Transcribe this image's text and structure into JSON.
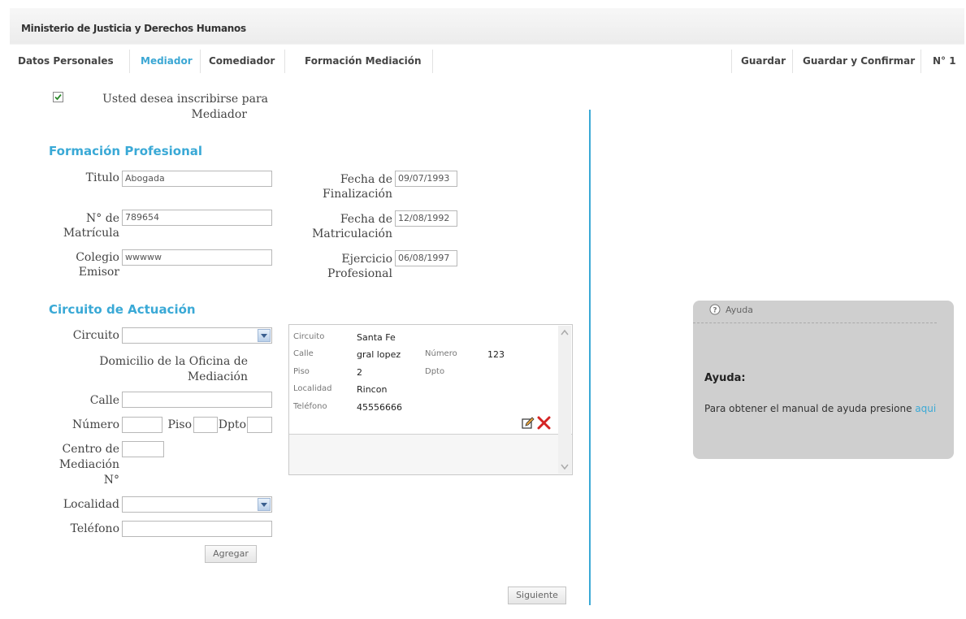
{
  "app_title": "Ministerio de Justicia y Derechos Humanos",
  "nav": {
    "tabs": [
      "Datos Personales",
      "Mediador",
      "Comediador",
      "Formación Mediación"
    ],
    "actions": [
      "Guardar",
      "Guardar y Confirmar",
      "N° 1"
    ]
  },
  "checkbox": {
    "label_line1": "Usted desea inscribirse para",
    "label_line2": "Mediador",
    "checked": true
  },
  "formacion": {
    "heading": "Formación Profesional",
    "titulo_label": "Titulo",
    "titulo_value": "Abogada",
    "matricula_label1": "N° de",
    "matricula_label2": "Matrícula",
    "matricula_value": "789654",
    "colegio_label1": "Colegio",
    "colegio_label2": "Emisor",
    "colegio_value": "wwwww",
    "fin_label1": "Fecha de",
    "fin_label2": "Finalización",
    "fin_value": "09/07/1993",
    "mat_label1": "Fecha de",
    "mat_label2": "Matriculación",
    "mat_value": "12/08/1992",
    "ej_label1": "Ejercicio",
    "ej_label2": "Profesional",
    "ej_value": "06/08/1997"
  },
  "circuito": {
    "heading": "Circuito de Actuación",
    "circuito_label": "Circuito",
    "domicilio_line1": "Domicilio de la Oficina de",
    "domicilio_line2": "Mediación",
    "calle_label": "Calle",
    "numero_label": "Número",
    "piso_label": "Piso",
    "dpto_label": "Dpto",
    "centro_line1": "Centro de",
    "centro_line2": "Mediación",
    "centro_line3": "N°",
    "localidad_label": "Localidad",
    "telefono_label": "Teléfono",
    "agregar": "Agregar"
  },
  "record": {
    "k_circuito": "Circuito",
    "v_circuito": "Santa Fe",
    "k_calle": "Calle",
    "v_calle": "gral lopez",
    "k_numero": "Número",
    "v_numero": "123",
    "k_piso": "Piso",
    "v_piso": "2",
    "k_dpto": "Dpto",
    "k_localidad": "Localidad",
    "v_localidad": "Rincon",
    "k_telefono": "Teléfono",
    "v_telefono": "45556666"
  },
  "siguiente": "Siguiente",
  "help": {
    "header": "Ayuda",
    "title": "Ayuda:",
    "text": "Para obtener el manual de ayuda presione",
    "link": "aqui"
  },
  "colors": {
    "accent": "#3aa9d6",
    "help_bg": "#cfcfcf"
  }
}
